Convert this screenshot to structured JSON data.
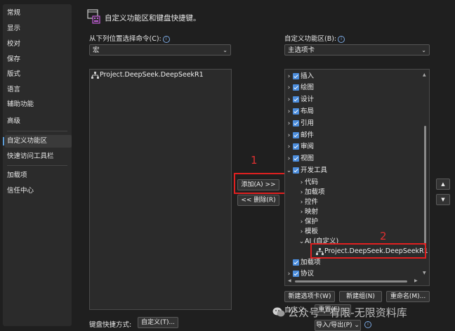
{
  "nav": {
    "items": [
      "常规",
      "显示",
      "校对",
      "保存",
      "版式",
      "语言",
      "辅助功能",
      "高级",
      "自定义功能区",
      "快速访问工具栏",
      "加载项",
      "信任中心"
    ],
    "active": "自定义功能区"
  },
  "header": {
    "title": "自定义功能区和键盘快捷键。"
  },
  "left": {
    "choose_label": "从下列位置选择命令(C):",
    "choose_value": "宏",
    "list_items": [
      "Project.DeepSeek.DeepSeekR1"
    ]
  },
  "right": {
    "customize_label": "自定义功能区(B):",
    "customize_value": "主选项卡",
    "tree": {
      "tabs": [
        "插入",
        "绘图",
        "设计",
        "布局",
        "引用",
        "邮件",
        "审阅",
        "视图"
      ],
      "dev_tab": "开发工具",
      "dev_groups": [
        "代码",
        "加载项",
        "控件",
        "映射",
        "保护",
        "模板"
      ],
      "ai_group": "AI (自定义)",
      "ai_item": "Project.DeepSeek.DeepSeekR1",
      "after_tabs": [
        "加载项",
        "协议"
      ]
    },
    "new_tab_button": "新建选项卡(W)",
    "new_group_button": "新建组(N)",
    "rename_button": "重命名(M)...",
    "custom_label": "自定义:",
    "reset_button": "重置(E)",
    "import_export_button": "导入/导出(P)"
  },
  "middle": {
    "add_button": "添加(A) >>",
    "remove_button": "<< 删除(R)"
  },
  "footer": {
    "shortcut_label": "键盘快捷方式:",
    "customize_button": "自定义(T)..."
  },
  "annotations": {
    "one": "1",
    "two": "2"
  },
  "watermark": "公众号 · 有限-无限资料库"
}
